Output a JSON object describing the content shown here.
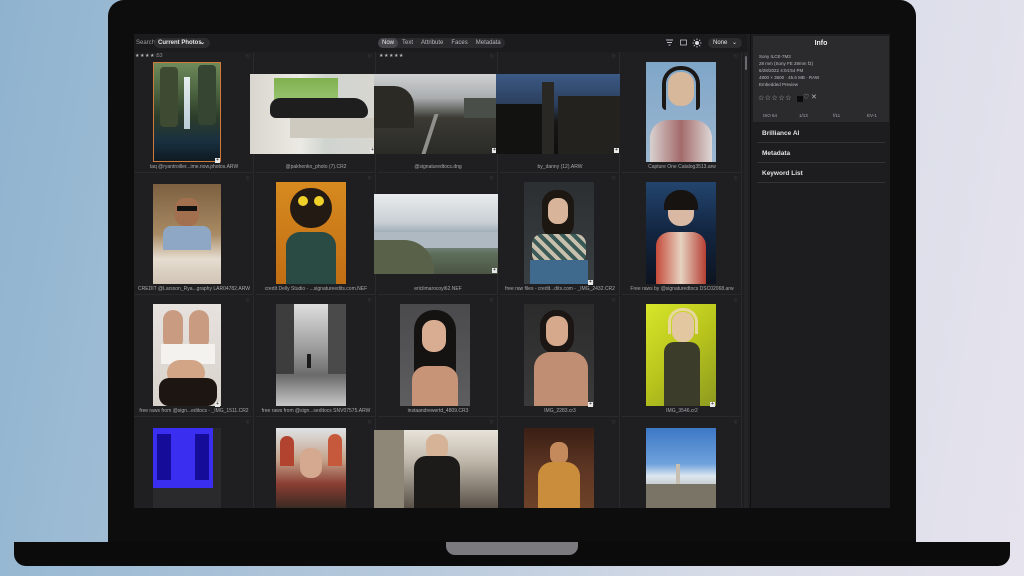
{
  "toolbar": {
    "search_label": "Search",
    "search_value": "Current Photos",
    "tabs": [
      "Now",
      "Text",
      "Attribute",
      "Faces",
      "Metadata"
    ],
    "active_tab": "Now",
    "sort_value": "None"
  },
  "grid": {
    "cells": [
      {
        "caption": "taq @ryantroiller...ime.now.photos.ARW",
        "stars": "★★★★☆",
        "star_count": "53",
        "selected": true
      },
      {
        "caption": "@pakhenko_photo (7).CR2"
      },
      {
        "caption": "@signaturedtocs.dng",
        "stars": "★★★★★"
      },
      {
        "caption": "by_danny (12).ARW"
      },
      {
        "caption": "Capture One Catalog3513.arw"
      },
      {
        "caption": "CREDIT @Larsson_Rya...graphy LAR04782.ARW"
      },
      {
        "caption": "credit Delly Studio - ...signatureedits.com.NEF"
      },
      {
        "caption": "ericlimarocoyi62.NEF"
      },
      {
        "caption": "free raw files - credit...dits.com - _IMG_2432.CR2"
      },
      {
        "caption": "Free raws by @signaturedtocs DSC02068.arw"
      },
      {
        "caption": "free raws from @sign...editocs - _IMG_1511.CR2"
      },
      {
        "caption": "free raws from @sign...seditocs SNV07575.ARW"
      },
      {
        "caption": "instaandrewertd_4809.CR3"
      },
      {
        "caption": "IMG_2283.cr3"
      },
      {
        "caption": "IMG_3546.cr2"
      },
      {
        "caption": ""
      },
      {
        "caption": ""
      },
      {
        "caption": ""
      },
      {
        "caption": ""
      },
      {
        "caption": ""
      }
    ]
  },
  "info_panel": {
    "title": "Info",
    "camera": "Sony ILCE-7M3",
    "lens": "28 mm (Sony FE 28mm f2)",
    "date": "6/28/2022 4:04:54 PM",
    "dims": "4800 × 3600 · 45.6 MB · RAW",
    "preview": "Embedded Preview",
    "rating": "☆☆☆☆☆",
    "heart": "♡",
    "reject": "✕",
    "exif": [
      "ISO 64",
      "1/13",
      "f/11",
      "EV-1"
    ]
  },
  "sections": [
    "Brilliance AI",
    "Metadata",
    "Keyword List"
  ],
  "colors": {
    "accent": "#d07a3a",
    "background": "#1f1f21",
    "panel": "#2b2b2e"
  }
}
